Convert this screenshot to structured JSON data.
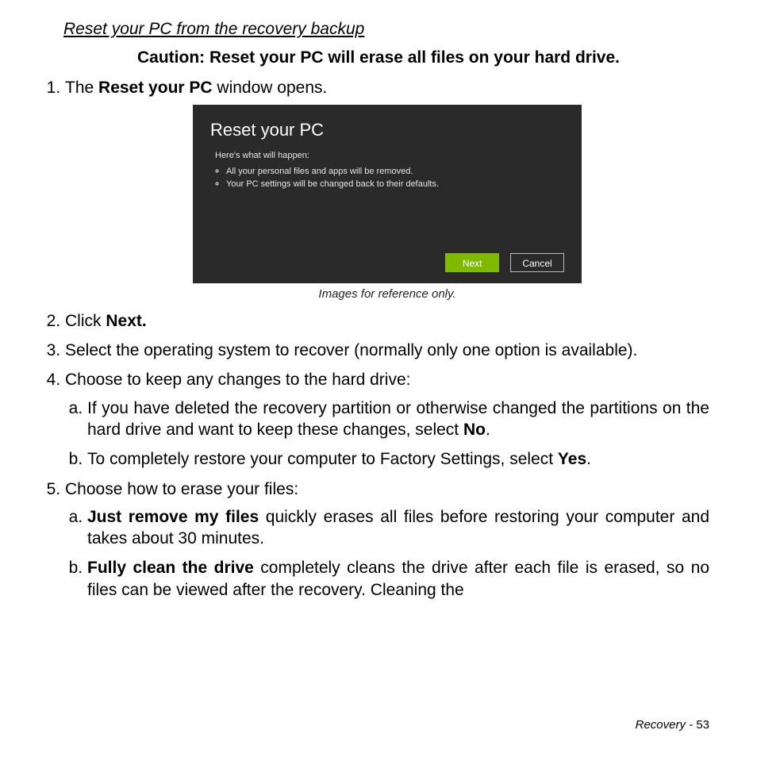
{
  "heading": "Reset your PC from the recovery backup",
  "caution": "Caution: Reset your PC will erase all files on your hard drive.",
  "step1_pre": "The ",
  "step1_bold": "Reset your PC",
  "step1_post": " window opens.",
  "screenshot": {
    "title": "Reset your PC",
    "subhead": "Here's what will happen:",
    "bullets": [
      "All your personal files and apps will be removed.",
      "Your PC settings will be changed back to their defaults."
    ],
    "next": "Next",
    "cancel": "Cancel"
  },
  "caption": "Images for reference only.",
  "step2_pre": "Click ",
  "step2_bold": "Next.",
  "step3": "Select the operating system to recover (normally only one option is available).",
  "step4": "Choose to keep any changes to the hard drive:",
  "step4a_pre": "If you have deleted the recovery partition or otherwise changed the partitions on the hard drive and want to keep these changes, select ",
  "step4a_bold": "No",
  "step4a_post": ".",
  "step4b_pre": "To completely restore your computer to Factory Settings, select ",
  "step4b_bold": "Yes",
  "step4b_post": ".",
  "step5": "Choose how to erase your files:",
  "step5a_bold": "Just remove my files",
  "step5a_post": " quickly erases all files before restoring your computer and takes about 30 minutes.",
  "step5b_bold": "Fully clean the drive",
  "step5b_post": " completely cleans the drive after each file is erased, so no files can be viewed after the recovery. Cleaning the",
  "footer_label": "Recovery -  ",
  "footer_page": "53"
}
